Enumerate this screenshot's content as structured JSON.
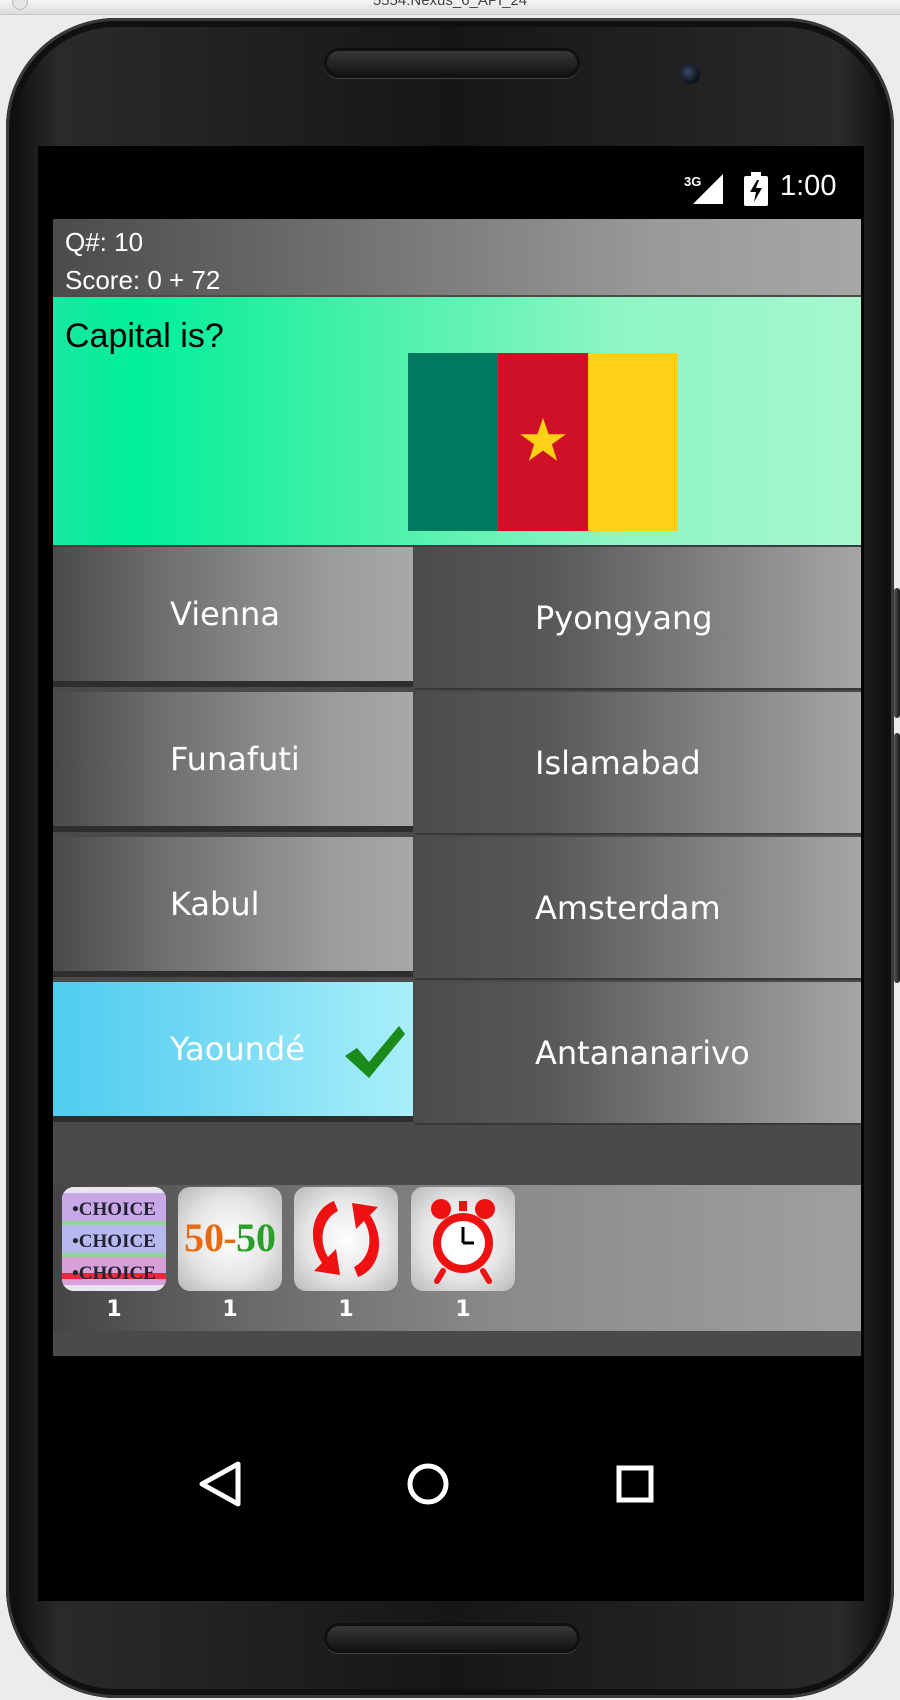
{
  "window": {
    "title": "5554:Nexus_6_API_24"
  },
  "status_bar": {
    "network_label": "3G",
    "time": "1:00"
  },
  "quiz": {
    "question_number": "Q#: 10",
    "score": "Score: 0 + 72",
    "question": "Capital is?",
    "flag": {
      "country_icon": "cameroon-flag",
      "colors": [
        "#007A5E",
        "#CE1126",
        "#FCD116"
      ],
      "star_color": "#FCD116"
    },
    "answers": [
      {
        "label": "Vienna",
        "state": "default"
      },
      {
        "label": "Pyongyang",
        "state": "default"
      },
      {
        "label": "Funafuti",
        "state": "default"
      },
      {
        "label": "Islamabad",
        "state": "default"
      },
      {
        "label": "Kabul",
        "state": "default"
      },
      {
        "label": "Amsterdam",
        "state": "default"
      },
      {
        "label": "Yaoundé",
        "state": "correct"
      },
      {
        "label": "Antananarivo",
        "state": "default"
      }
    ],
    "correct_color": "#4fcdf0",
    "check_color": "#1a8a1a"
  },
  "lifelines": [
    {
      "name": "multiple-choice",
      "icon_text": "•CHOICE",
      "count": "1"
    },
    {
      "name": "fifty-fifty",
      "icon_text_left": "50",
      "icon_text_sep": "-",
      "icon_text_right": "50",
      "count": "1"
    },
    {
      "name": "swap-question",
      "icon": "refresh-arrows-icon",
      "count": "1"
    },
    {
      "name": "extra-time",
      "icon": "alarm-clock-icon",
      "count": "1"
    }
  ],
  "nav": {
    "back_icon": "back-triangle-icon",
    "home_icon": "home-circle-icon",
    "recents_icon": "recents-square-icon"
  }
}
